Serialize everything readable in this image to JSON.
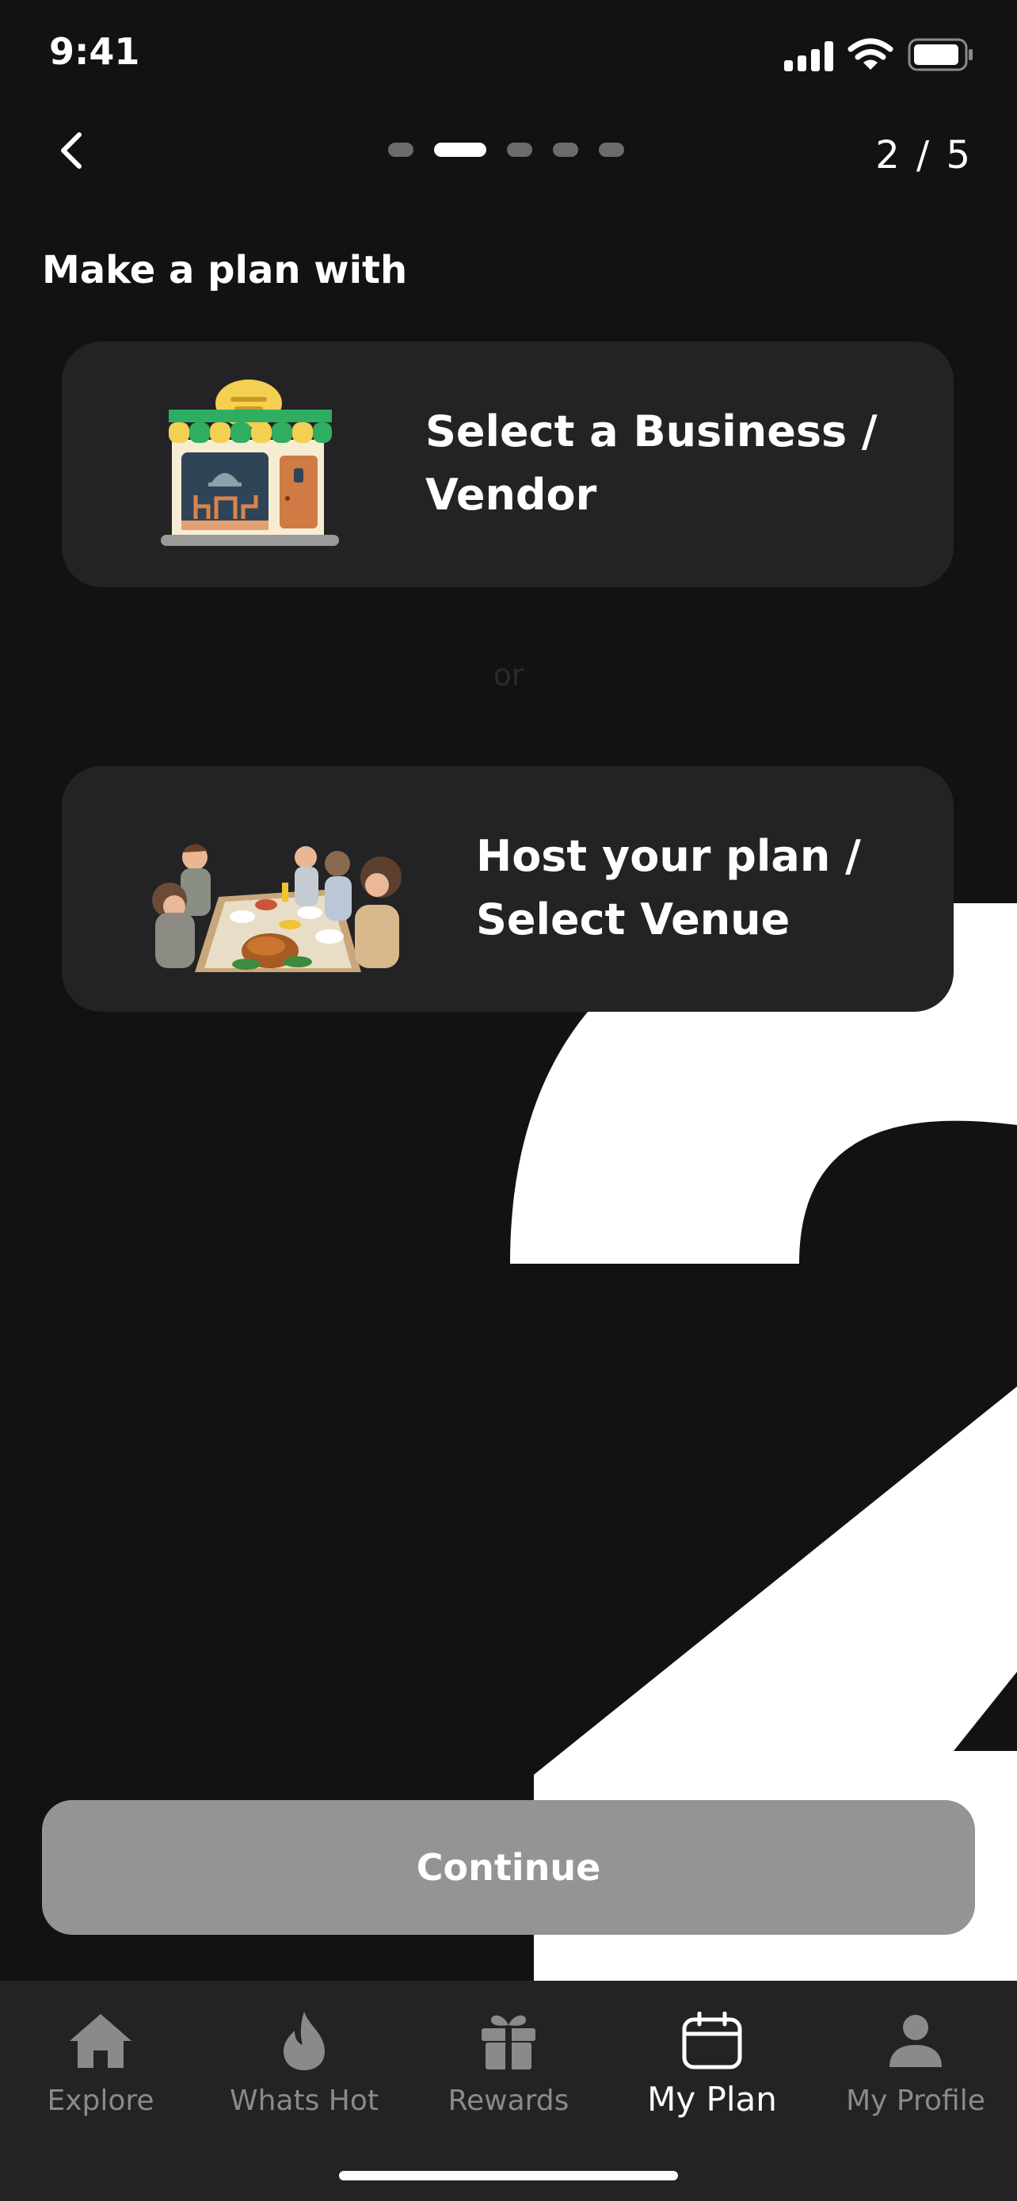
{
  "status_bar": {
    "time": "9:41"
  },
  "header": {
    "step_counter": "2 / 5",
    "total_steps": 5,
    "current_step": 2
  },
  "section": {
    "title": "Make a plan with"
  },
  "options": [
    {
      "title_line1": "Select a Business /",
      "title_line2": "Vendor",
      "icon": "storefront-illustration"
    },
    {
      "title_line1": "Host your plan /",
      "title_line2": "Select Venue",
      "icon": "dinner-party-illustration"
    }
  ],
  "separator": {
    "text": "or"
  },
  "continue_button": {
    "label": "Continue"
  },
  "tabs": [
    {
      "label": "Explore",
      "icon": "home-icon"
    },
    {
      "label": "Whats Hot",
      "icon": "flame-icon"
    },
    {
      "label": "Rewards",
      "icon": "gift-icon"
    },
    {
      "label": "My Plan",
      "icon": "calendar-icon",
      "active": true
    },
    {
      "label": "My Profile",
      "icon": "person-icon"
    }
  ],
  "colors": {
    "background": "#121212",
    "card": "#232325",
    "button_disabled": "#949494",
    "tabbar": "#232325"
  }
}
